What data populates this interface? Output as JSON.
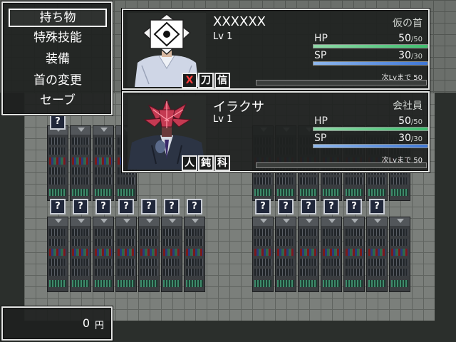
{
  "menu": {
    "items": [
      {
        "label": "持ち物",
        "selected": true
      },
      {
        "label": "特殊技能",
        "selected": false
      },
      {
        "label": "装備",
        "selected": false
      },
      {
        "label": "首の変更",
        "selected": false
      },
      {
        "label": "セーブ",
        "selected": false
      }
    ]
  },
  "party": [
    {
      "name": "XXXXXX",
      "level": "Lv 1",
      "class": "仮の首",
      "hp_label": "HP",
      "hp": "50",
      "hp_max": "/50",
      "hp_ratio": 1.0,
      "sp_label": "SP",
      "sp": "30",
      "sp_max": "/30",
      "sp_ratio": 1.0,
      "next_label": "次Lvまで",
      "next_value": "50",
      "badges": [
        "X",
        "刀",
        "信"
      ],
      "portrait": "paper-bag-head-man"
    },
    {
      "name": "イラクサ",
      "level": "Lv 1",
      "class": "会社員",
      "hp_label": "HP",
      "hp": "50",
      "hp_max": "/50",
      "hp_ratio": 1.0,
      "sp_label": "SP",
      "sp": "30",
      "sp_max": "/30",
      "sp_ratio": 1.0,
      "next_label": "次Lvまで",
      "next_value": "50",
      "badges": [
        "人",
        "鈍",
        "科"
      ],
      "portrait": "nettle-head-businessman"
    }
  ],
  "gold": {
    "value": "0",
    "unit": "円"
  },
  "map": {
    "question_mark": "?"
  },
  "colors": {
    "hp": "#3fbf6f",
    "sp": "#3f78d8",
    "badge_x": "#ff3b3b"
  }
}
